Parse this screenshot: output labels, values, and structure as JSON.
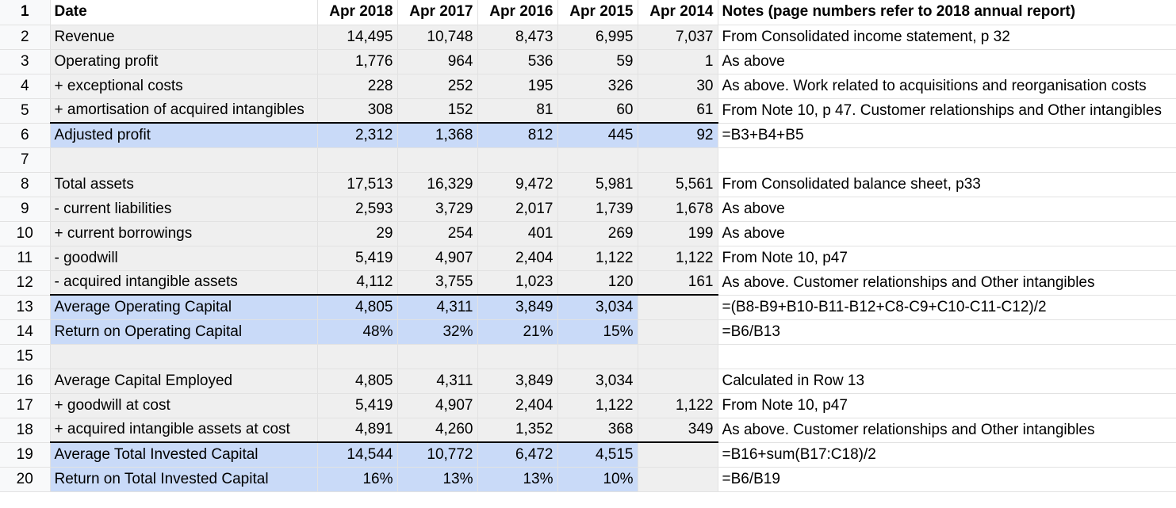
{
  "sheet": {
    "header": {
      "rownum": "1",
      "label": "Date",
      "cols": [
        "Apr 2018",
        "Apr 2017",
        "Apr 2016",
        "Apr 2015",
        "Apr 2014"
      ],
      "notes": "Notes (page numbers refer to 2018 annual report)"
    },
    "rows": [
      {
        "n": "2",
        "label": "Revenue",
        "b": "14,495",
        "c": "10,748",
        "d": "8,473",
        "e": "6,995",
        "f": "7,037",
        "note": "From Consolidated income statement, p 32"
      },
      {
        "n": "3",
        "label": "Operating profit",
        "b": "1,776",
        "c": "964",
        "d": "536",
        "e": "59",
        "f": "1",
        "note": "As above"
      },
      {
        "n": "4",
        "label": "+ exceptional costs",
        "b": "228",
        "c": "252",
        "d": "195",
        "e": "326",
        "f": "30",
        "note": "As above. Work related to acquisitions and reorganisation costs"
      },
      {
        "n": "5",
        "label": "+ amortisation of acquired intangibles",
        "b": "308",
        "c": "152",
        "d": "81",
        "e": "60",
        "f": "61",
        "note": "From Note 10, p 47. Customer relationships and Other intangibles"
      },
      {
        "n": "6",
        "label": "Adjusted profit",
        "b": "2,312",
        "c": "1,368",
        "d": "812",
        "e": "445",
        "f": "92",
        "note": "=B3+B4+B5"
      },
      {
        "n": "7",
        "label": "",
        "b": "",
        "c": "",
        "d": "",
        "e": "",
        "f": "",
        "note": ""
      },
      {
        "n": "8",
        "label": "Total assets",
        "b": "17,513",
        "c": "16,329",
        "d": "9,472",
        "e": "5,981",
        "f": "5,561",
        "note": "From Consolidated balance sheet, p33"
      },
      {
        "n": "9",
        "label": "- current liabilities",
        "b": "2,593",
        "c": "3,729",
        "d": "2,017",
        "e": "1,739",
        "f": "1,678",
        "note": "As above"
      },
      {
        "n": "10",
        "label": "+ current borrowings",
        "b": "29",
        "c": "254",
        "d": "401",
        "e": "269",
        "f": "199",
        "note": "As above"
      },
      {
        "n": "11",
        "label": "- goodwill",
        "b": "5,419",
        "c": "4,907",
        "d": "2,404",
        "e": "1,122",
        "f": "1,122",
        "note": "From Note 10, p47"
      },
      {
        "n": "12",
        "label": "- acquired intangible assets",
        "b": "4,112",
        "c": "3,755",
        "d": "1,023",
        "e": "120",
        "f": "161",
        "note": "As above. Customer relationships and Other intangibles"
      },
      {
        "n": "13",
        "label": "Average Operating Capital",
        "b": "4,805",
        "c": "4,311",
        "d": "3,849",
        "e": "3,034",
        "f": "",
        "note": "=(B8-B9+B10-B11-B12+C8-C9+C10-C11-C12)/2"
      },
      {
        "n": "14",
        "label": "Return on Operating Capital",
        "b": "48%",
        "c": "32%",
        "d": "21%",
        "e": "15%",
        "f": "",
        "note": "=B6/B13"
      },
      {
        "n": "15",
        "label": "",
        "b": "",
        "c": "",
        "d": "",
        "e": "",
        "f": "",
        "note": ""
      },
      {
        "n": "16",
        "label": "Average Capital Employed",
        "b": "4,805",
        "c": "4,311",
        "d": "3,849",
        "e": "3,034",
        "f": "",
        "note": "Calculated in Row 13"
      },
      {
        "n": "17",
        "label": "+ goodwill at cost",
        "b": "5,419",
        "c": "4,907",
        "d": "2,404",
        "e": "1,122",
        "f": "1,122",
        "note": "From Note 10, p47"
      },
      {
        "n": "18",
        "label": "+ acquired intangible assets at cost",
        "b": "4,891",
        "c": "4,260",
        "d": "1,352",
        "e": "368",
        "f": "349",
        "note": "As above. Customer relationships and Other intangibles"
      },
      {
        "n": "19",
        "label": "Average Total Invested Capital",
        "b": "14,544",
        "c": "10,772",
        "d": "6,472",
        "e": "4,515",
        "f": "",
        "note": "=B16+sum(B17:C18)/2"
      },
      {
        "n": "20",
        "label": "Return on Total Invested Capital",
        "b": "16%",
        "c": "13%",
        "d": "13%",
        "e": "10%",
        "f": "",
        "note": "=B6/B19"
      }
    ]
  }
}
